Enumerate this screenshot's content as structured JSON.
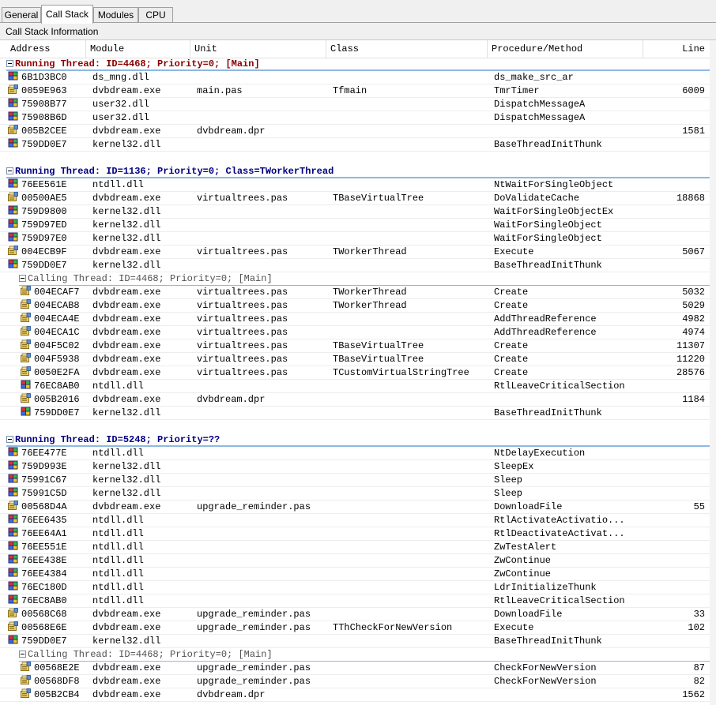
{
  "tabs": [
    {
      "label": "General",
      "active": false
    },
    {
      "label": "Call Stack",
      "active": true
    },
    {
      "label": "Modules",
      "active": false
    },
    {
      "label": "CPU",
      "active": false
    }
  ],
  "panel_title": "Call Stack Information",
  "columns": [
    "Address",
    "Module",
    "Unit",
    "Class",
    "Procedure/Method",
    "Line"
  ],
  "items": [
    {
      "kind": "group",
      "level": 0,
      "text": "Running Thread: ID=4468; Priority=0; [Main]",
      "color": "#8b0000"
    },
    {
      "kind": "row",
      "level": 0,
      "icon": "system",
      "address": "6B1D3BC0",
      "module": "ds_mng.dll",
      "unit": "",
      "cls": "",
      "proc": "ds_make_src_ar",
      "line": ""
    },
    {
      "kind": "row",
      "level": 0,
      "icon": "user",
      "address": "0059E963",
      "module": "dvbdream.exe",
      "unit": "main.pas",
      "cls": "Tfmain",
      "proc": "TmrTimer",
      "line": "6009"
    },
    {
      "kind": "row",
      "level": 0,
      "icon": "system",
      "address": "75908B77",
      "module": "user32.dll",
      "unit": "",
      "cls": "",
      "proc": "DispatchMessageA",
      "line": ""
    },
    {
      "kind": "row",
      "level": 0,
      "icon": "system",
      "address": "75908B6D",
      "module": "user32.dll",
      "unit": "",
      "cls": "",
      "proc": "DispatchMessageA",
      "line": ""
    },
    {
      "kind": "row",
      "level": 0,
      "icon": "user",
      "address": "005B2CEE",
      "module": "dvbdream.exe",
      "unit": "dvbdream.dpr",
      "cls": "",
      "proc": "",
      "line": "1581"
    },
    {
      "kind": "row",
      "level": 0,
      "icon": "system",
      "address": "759DD0E7",
      "module": "kernel32.dll",
      "unit": "",
      "cls": "",
      "proc": "BaseThreadInitThunk",
      "line": ""
    },
    {
      "kind": "blank"
    },
    {
      "kind": "group",
      "level": 0,
      "text": "Running Thread: ID=1136; Priority=0; Class=TWorkerThread",
      "color": "#00007f"
    },
    {
      "kind": "row",
      "level": 0,
      "icon": "system",
      "address": "76EE561E",
      "module": "ntdll.dll",
      "unit": "",
      "cls": "",
      "proc": "NtWaitForSingleObject",
      "line": ""
    },
    {
      "kind": "row",
      "level": 0,
      "icon": "user",
      "address": "00500AE5",
      "module": "dvbdream.exe",
      "unit": "virtualtrees.pas",
      "cls": "TBaseVirtualTree",
      "proc": "DoValidateCache",
      "line": "18868"
    },
    {
      "kind": "row",
      "level": 0,
      "icon": "system",
      "address": "759D9800",
      "module": "kernel32.dll",
      "unit": "",
      "cls": "",
      "proc": "WaitForSingleObjectEx",
      "line": ""
    },
    {
      "kind": "row",
      "level": 0,
      "icon": "system",
      "address": "759D97ED",
      "module": "kernel32.dll",
      "unit": "",
      "cls": "",
      "proc": "WaitForSingleObject",
      "line": ""
    },
    {
      "kind": "row",
      "level": 0,
      "icon": "system",
      "address": "759D97E0",
      "module": "kernel32.dll",
      "unit": "",
      "cls": "",
      "proc": "WaitForSingleObject",
      "line": ""
    },
    {
      "kind": "row",
      "level": 0,
      "icon": "user",
      "address": "004ECB9F",
      "module": "dvbdream.exe",
      "unit": "virtualtrees.pas",
      "cls": "TWorkerThread",
      "proc": "Execute",
      "line": "5067"
    },
    {
      "kind": "row",
      "level": 0,
      "icon": "system",
      "address": "759DD0E7",
      "module": "kernel32.dll",
      "unit": "",
      "cls": "",
      "proc": "BaseThreadInitThunk",
      "line": ""
    },
    {
      "kind": "group",
      "level": 1,
      "text": "Calling Thread: ID=4468; Priority=0; [Main]",
      "color": "#505050"
    },
    {
      "kind": "row",
      "level": 1,
      "icon": "user",
      "address": "004ECAF7",
      "module": "dvbdream.exe",
      "unit": "virtualtrees.pas",
      "cls": "TWorkerThread",
      "proc": "Create",
      "line": "5032"
    },
    {
      "kind": "row",
      "level": 1,
      "icon": "user",
      "address": "004ECAB8",
      "module": "dvbdream.exe",
      "unit": "virtualtrees.pas",
      "cls": "TWorkerThread",
      "proc": "Create",
      "line": "5029"
    },
    {
      "kind": "row",
      "level": 1,
      "icon": "user",
      "address": "004ECA4E",
      "module": "dvbdream.exe",
      "unit": "virtualtrees.pas",
      "cls": "",
      "proc": "AddThreadReference",
      "line": "4982"
    },
    {
      "kind": "row",
      "level": 1,
      "icon": "user",
      "address": "004ECA1C",
      "module": "dvbdream.exe",
      "unit": "virtualtrees.pas",
      "cls": "",
      "proc": "AddThreadReference",
      "line": "4974"
    },
    {
      "kind": "row",
      "level": 1,
      "icon": "user",
      "address": "004F5C02",
      "module": "dvbdream.exe",
      "unit": "virtualtrees.pas",
      "cls": "TBaseVirtualTree",
      "proc": "Create",
      "line": "11307"
    },
    {
      "kind": "row",
      "level": 1,
      "icon": "user",
      "address": "004F5938",
      "module": "dvbdream.exe",
      "unit": "virtualtrees.pas",
      "cls": "TBaseVirtualTree",
      "proc": "Create",
      "line": "11220"
    },
    {
      "kind": "row",
      "level": 1,
      "icon": "user",
      "address": "0050E2FA",
      "module": "dvbdream.exe",
      "unit": "virtualtrees.pas",
      "cls": "TCustomVirtualStringTree",
      "proc": "Create",
      "line": "28576"
    },
    {
      "kind": "row",
      "level": 1,
      "icon": "system",
      "address": "76EC8AB0",
      "module": "ntdll.dll",
      "unit": "",
      "cls": "",
      "proc": "RtlLeaveCriticalSection",
      "line": ""
    },
    {
      "kind": "row",
      "level": 1,
      "icon": "user",
      "address": "005B2016",
      "module": "dvbdream.exe",
      "unit": "dvbdream.dpr",
      "cls": "",
      "proc": "",
      "line": "1184"
    },
    {
      "kind": "row",
      "level": 1,
      "icon": "system",
      "address": "759DD0E7",
      "module": "kernel32.dll",
      "unit": "",
      "cls": "",
      "proc": "BaseThreadInitThunk",
      "line": ""
    },
    {
      "kind": "blank"
    },
    {
      "kind": "group",
      "level": 0,
      "text": "Running Thread: ID=5248; Priority=??",
      "color": "#00007f"
    },
    {
      "kind": "row",
      "level": 0,
      "icon": "system",
      "address": "76EE477E",
      "module": "ntdll.dll",
      "unit": "",
      "cls": "",
      "proc": "NtDelayExecution",
      "line": ""
    },
    {
      "kind": "row",
      "level": 0,
      "icon": "system",
      "address": "759D993E",
      "module": "kernel32.dll",
      "unit": "",
      "cls": "",
      "proc": "SleepEx",
      "line": ""
    },
    {
      "kind": "row",
      "level": 0,
      "icon": "system",
      "address": "75991C67",
      "module": "kernel32.dll",
      "unit": "",
      "cls": "",
      "proc": "Sleep",
      "line": ""
    },
    {
      "kind": "row",
      "level": 0,
      "icon": "system",
      "address": "75991C5D",
      "module": "kernel32.dll",
      "unit": "",
      "cls": "",
      "proc": "Sleep",
      "line": ""
    },
    {
      "kind": "row",
      "level": 0,
      "icon": "user",
      "address": "00568D4A",
      "module": "dvbdream.exe",
      "unit": "upgrade_reminder.pas",
      "cls": "",
      "proc": "DownloadFile",
      "line": "55"
    },
    {
      "kind": "row",
      "level": 0,
      "icon": "system",
      "address": "76EE6435",
      "module": "ntdll.dll",
      "unit": "",
      "cls": "",
      "proc": "RtlActivateActivatio...",
      "line": ""
    },
    {
      "kind": "row",
      "level": 0,
      "icon": "system",
      "address": "76EE64A1",
      "module": "ntdll.dll",
      "unit": "",
      "cls": "",
      "proc": "RtlDeactivateActivat...",
      "line": ""
    },
    {
      "kind": "row",
      "level": 0,
      "icon": "system",
      "address": "76EE551E",
      "module": "ntdll.dll",
      "unit": "",
      "cls": "",
      "proc": "ZwTestAlert",
      "line": ""
    },
    {
      "kind": "row",
      "level": 0,
      "icon": "system",
      "address": "76EE438E",
      "module": "ntdll.dll",
      "unit": "",
      "cls": "",
      "proc": "ZwContinue",
      "line": ""
    },
    {
      "kind": "row",
      "level": 0,
      "icon": "system",
      "address": "76EE4384",
      "module": "ntdll.dll",
      "unit": "",
      "cls": "",
      "proc": "ZwContinue",
      "line": ""
    },
    {
      "kind": "row",
      "level": 0,
      "icon": "system",
      "address": "76EC180D",
      "module": "ntdll.dll",
      "unit": "",
      "cls": "",
      "proc": "LdrInitializeThunk",
      "line": ""
    },
    {
      "kind": "row",
      "level": 0,
      "icon": "system",
      "address": "76EC8AB0",
      "module": "ntdll.dll",
      "unit": "",
      "cls": "",
      "proc": "RtlLeaveCriticalSection",
      "line": ""
    },
    {
      "kind": "row",
      "level": 0,
      "icon": "user",
      "address": "00568C68",
      "module": "dvbdream.exe",
      "unit": "upgrade_reminder.pas",
      "cls": "",
      "proc": "DownloadFile",
      "line": "33"
    },
    {
      "kind": "row",
      "level": 0,
      "icon": "user",
      "address": "00568E6E",
      "module": "dvbdream.exe",
      "unit": "upgrade_reminder.pas",
      "cls": "TThCheckForNewVersion",
      "proc": "Execute",
      "line": "102"
    },
    {
      "kind": "row",
      "level": 0,
      "icon": "system",
      "address": "759DD0E7",
      "module": "kernel32.dll",
      "unit": "",
      "cls": "",
      "proc": "BaseThreadInitThunk",
      "line": ""
    },
    {
      "kind": "group",
      "level": 1,
      "text": "Calling Thread: ID=4468; Priority=0; [Main]",
      "color": "#505050"
    },
    {
      "kind": "row",
      "level": 1,
      "icon": "user",
      "address": "00568E2E",
      "module": "dvbdream.exe",
      "unit": "upgrade_reminder.pas",
      "cls": "",
      "proc": "CheckForNewVersion",
      "line": "87"
    },
    {
      "kind": "row",
      "level": 1,
      "icon": "user",
      "address": "00568DF8",
      "module": "dvbdream.exe",
      "unit": "upgrade_reminder.pas",
      "cls": "",
      "proc": "CheckForNewVersion",
      "line": "82"
    },
    {
      "kind": "row",
      "level": 1,
      "icon": "user",
      "address": "005B2CB4",
      "module": "dvbdream.exe",
      "unit": "dvbdream.dpr",
      "cls": "",
      "proc": "",
      "line": "1562"
    }
  ]
}
